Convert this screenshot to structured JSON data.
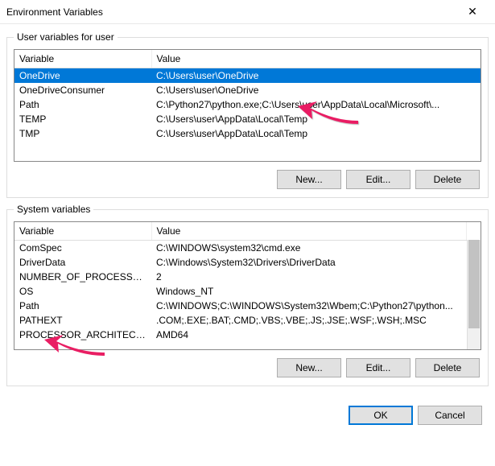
{
  "window": {
    "title": "Environment Variables",
    "close_icon": "✕"
  },
  "user_section": {
    "label": "User variables for user",
    "columns": {
      "var": "Variable",
      "val": "Value"
    },
    "rows": [
      {
        "var": "OneDrive",
        "val": "C:\\Users\\user\\OneDrive",
        "selected": true
      },
      {
        "var": "OneDriveConsumer",
        "val": "C:\\Users\\user\\OneDrive"
      },
      {
        "var": "Path",
        "val": "C:\\Python27\\python.exe;C:\\Users\\user\\AppData\\Local\\Microsoft\\..."
      },
      {
        "var": "TEMP",
        "val": "C:\\Users\\user\\AppData\\Local\\Temp"
      },
      {
        "var": "TMP",
        "val": "C:\\Users\\user\\AppData\\Local\\Temp"
      }
    ],
    "buttons": {
      "new": "New...",
      "edit": "Edit...",
      "delete": "Delete"
    }
  },
  "system_section": {
    "label": "System variables",
    "columns": {
      "var": "Variable",
      "val": "Value"
    },
    "rows": [
      {
        "var": "ComSpec",
        "val": "C:\\WINDOWS\\system32\\cmd.exe"
      },
      {
        "var": "DriverData",
        "val": "C:\\Windows\\System32\\Drivers\\DriverData"
      },
      {
        "var": "NUMBER_OF_PROCESSORS",
        "val": "2"
      },
      {
        "var": "OS",
        "val": "Windows_NT"
      },
      {
        "var": "Path",
        "val": "C:\\WINDOWS;C:\\WINDOWS\\System32\\Wbem;C:\\Python27\\python..."
      },
      {
        "var": "PATHEXT",
        "val": ".COM;.EXE;.BAT;.CMD;.VBS;.VBE;.JS;.JSE;.WSF;.WSH;.MSC"
      },
      {
        "var": "PROCESSOR_ARCHITECTURE",
        "val": "AMD64"
      }
    ],
    "buttons": {
      "new": "New...",
      "edit": "Edit...",
      "delete": "Delete"
    }
  },
  "footer": {
    "ok": "OK",
    "cancel": "Cancel"
  },
  "colors": {
    "arrow": "#e91e63"
  }
}
